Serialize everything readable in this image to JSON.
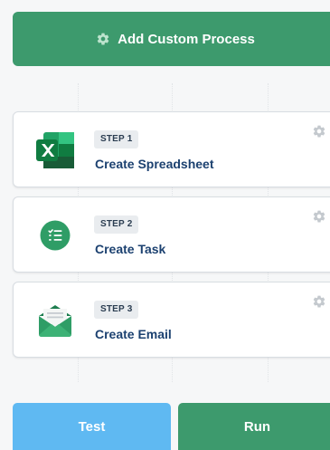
{
  "add_process": {
    "label": "Add Custom Process",
    "icon": "gear-icon"
  },
  "steps": [
    {
      "badge": "STEP 1",
      "title": "Create Spreadsheet",
      "icon": "excel-icon"
    },
    {
      "badge": "STEP 2",
      "title": "Create Task",
      "icon": "task-list-icon"
    },
    {
      "badge": "STEP 3",
      "title": "Create Email",
      "icon": "email-icon"
    }
  ],
  "actions": {
    "test_label": "Test",
    "run_label": "Run"
  },
  "colors": {
    "primary_green": "#3d9a6d",
    "test_blue": "#5fb9f2",
    "title_navy": "#1c4170",
    "badge_bg": "#e9ecef"
  }
}
